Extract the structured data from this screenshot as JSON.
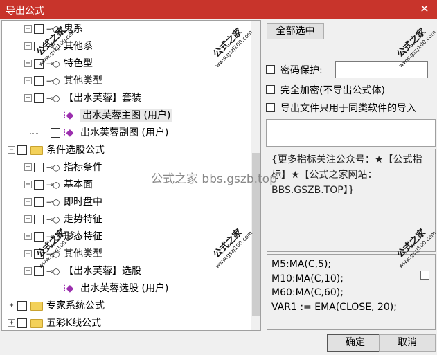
{
  "window": {
    "title": "导出公式",
    "close_glyph": "✕",
    "accent": "#c8342b"
  },
  "tree": {
    "nodes": [
      {
        "label": "鬼系",
        "expander": "+",
        "icon": "key-icon"
      },
      {
        "label": "其他系",
        "expander": "+",
        "icon": "key-icon"
      },
      {
        "label": "特色型",
        "expander": "+",
        "icon": "key-icon"
      },
      {
        "label": "其他类型",
        "expander": "+",
        "icon": "key-icon"
      },
      {
        "label": "【出水芙蓉】套装",
        "expander": "−",
        "icon": "key-icon"
      },
      {
        "label": "出水芙蓉主图 (用户)",
        "icon": "gem-icon",
        "selected": true
      },
      {
        "label": "出水芙蓉副图 (用户)",
        "icon": "gem-icon"
      },
      {
        "label": "条件选股公式",
        "expander": "−",
        "icon": "folder-icon"
      },
      {
        "label": "指标条件",
        "expander": "+",
        "icon": "key-icon"
      },
      {
        "label": "基本面",
        "expander": "+",
        "icon": "key-icon"
      },
      {
        "label": "即时盘中",
        "expander": "+",
        "icon": "key-icon"
      },
      {
        "label": "走势特征",
        "expander": "+",
        "icon": "key-icon"
      },
      {
        "label": "形态特征",
        "expander": "+",
        "icon": "key-icon"
      },
      {
        "label": "其他类型",
        "expander": "+",
        "icon": "key-icon"
      },
      {
        "label": "【出水芙蓉】选股",
        "expander": "−",
        "icon": "key-icon"
      },
      {
        "label": "出水芙蓉选股 (用户)",
        "icon": "gem-icon"
      },
      {
        "label": "专家系统公式",
        "expander": "+",
        "icon": "folder-icon"
      },
      {
        "label": "五彩K线公式",
        "expander": "+",
        "icon": "folder-icon"
      }
    ]
  },
  "options": {
    "select_all": "全部选中",
    "password_protect": "密码保护:",
    "full_encrypt": "完全加密(不导出公式体)",
    "same_software_only": "导出文件只用于同类软件的导入"
  },
  "info_text": "{更多指标关注公众号：★【公式指标】★【公式之家网站：BBS.GSZB.TOP】}",
  "code_lines": [
    "M5:MA(C,5);",
    "M10:MA(C,10);",
    "M60:MA(C,60);",
    "VAR1 := EMA(CLOSE, 20);"
  ],
  "buttons": {
    "ok": "确定",
    "cancel": "取消"
  },
  "watermark": {
    "main": "公式之家",
    "sub": "www.gszj100.com",
    "center": "公式之家 bbs.gszb.top"
  }
}
